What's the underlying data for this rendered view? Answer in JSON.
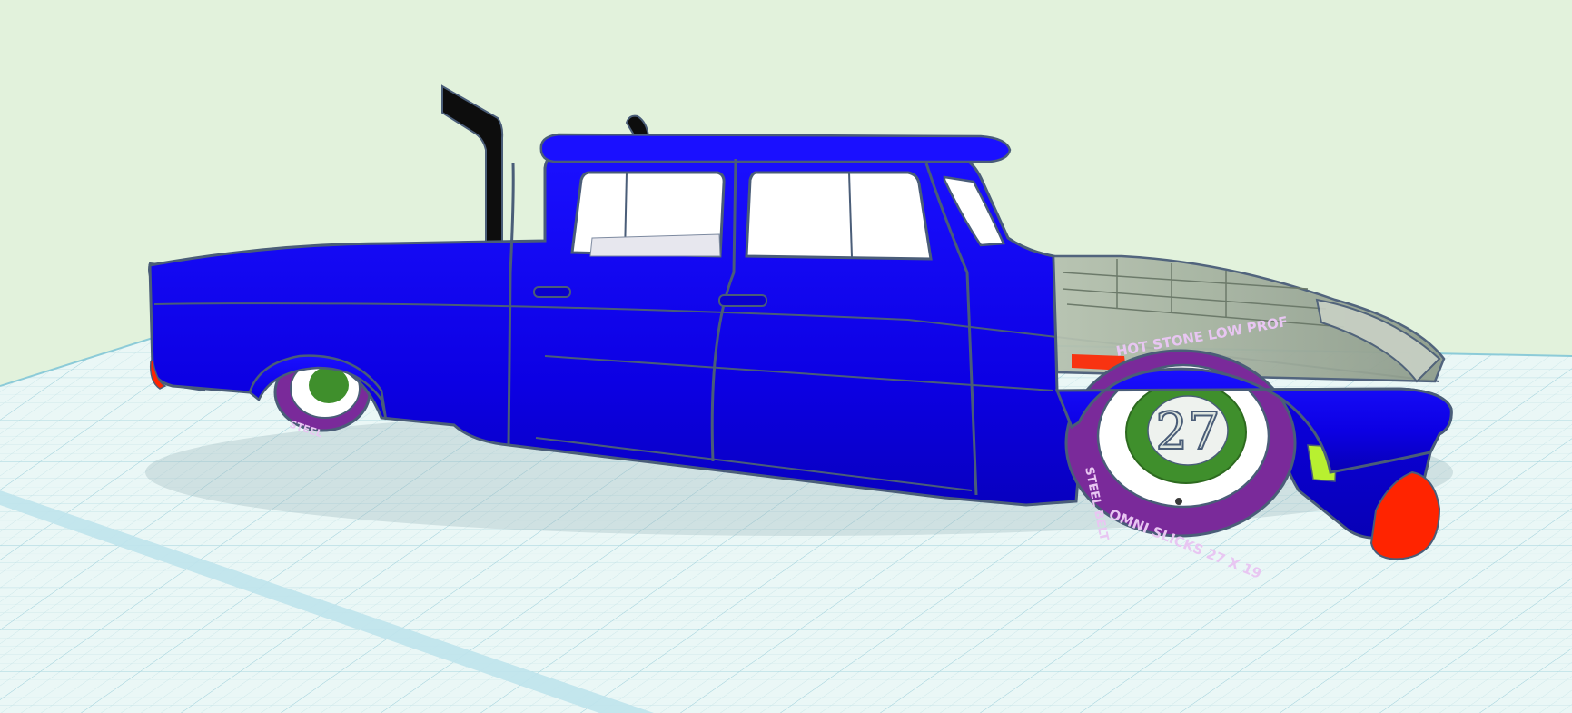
{
  "app": {
    "view": "3d-workplane"
  },
  "colors": {
    "background": "#e2f2dc",
    "workplane": "#e9f6f5",
    "grid_line": "#b9dde3",
    "grid_major": "#8ccbd8",
    "body": "#0c00e3",
    "body_dark": "#0800b0",
    "outline": "#4a5d78",
    "stack": "#0d0d0d",
    "tire": "#7a2a9a",
    "rim": "#ffffff",
    "hub": "#3f8f2c",
    "mudflap": "#ff2400",
    "accent_green": "#b8f030",
    "engine_glass": "#a6b3a1"
  },
  "model": {
    "name_icon": "blue-dually-pickup-model",
    "front_tire": {
      "number": "27",
      "lettering_top": "HOT STONE LOW PROF",
      "lettering_bottom": "OMNI SLICKS 27 X 19",
      "lettering_side": "STEEL BELT"
    },
    "rear_tire": {
      "lettering": "STEEL"
    }
  }
}
